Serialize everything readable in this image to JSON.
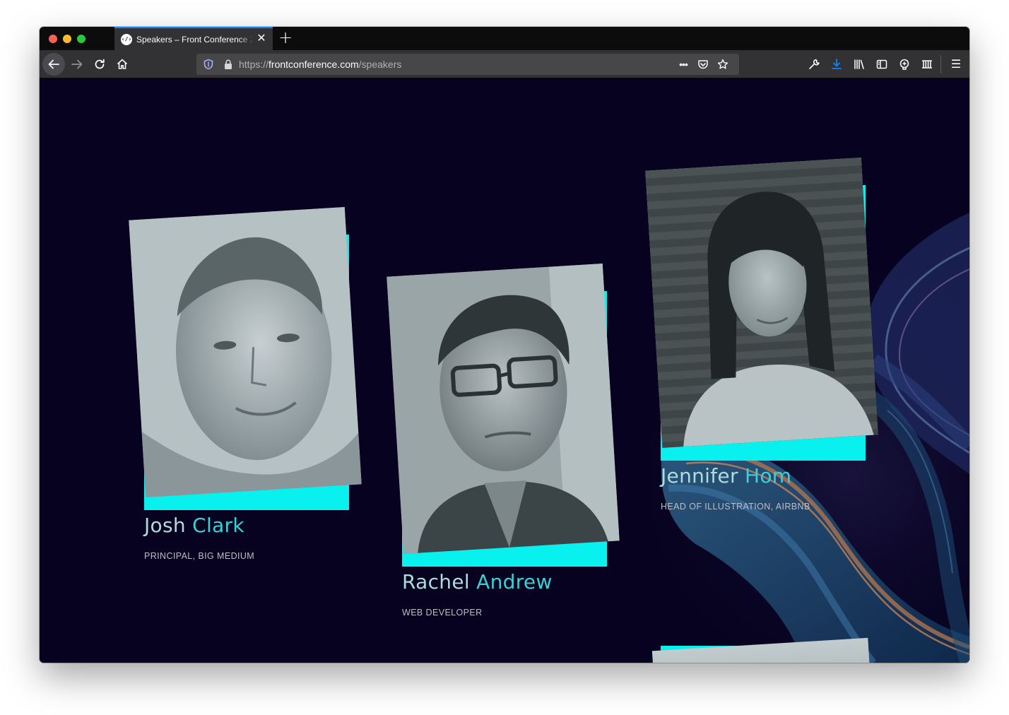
{
  "browser": {
    "tab_title": "Speakers – Front Conference Zürich",
    "favicon_glyph": "‹/›",
    "close_glyph": "✕",
    "newtab_glyph": "+",
    "url_scheme": "https://",
    "url_host": "frontconference.com",
    "url_path": "/speakers",
    "page_actions_glyph": "•••",
    "menu_glyph": "☰"
  },
  "speakers": [
    {
      "first": "Josh",
      "last": "Clark",
      "role": "PRINCIPAL, BIG MEDIUM"
    },
    {
      "first": "Rachel",
      "last": "Andrew",
      "role": "WEB DEVELOPER"
    },
    {
      "first": "Jennifer",
      "last": "Hom",
      "role": "HEAD OF ILLUSTRATION, AIRBNB"
    }
  ],
  "colors": {
    "page_bg": "#06021f",
    "accent_cyan": "#08f1ee",
    "name_first": "#aedcdc",
    "name_last": "#3ad1d4",
    "download_blue": "#0a84ff"
  },
  "icons": [
    "shield-icon",
    "lock-icon",
    "bookmark-star-icon",
    "pocket-icon",
    "wrench-icon",
    "download-icon",
    "library-icon",
    "sidebar-icon",
    "extension-icon",
    "container-icon",
    "hamburger-menu-icon"
  ]
}
